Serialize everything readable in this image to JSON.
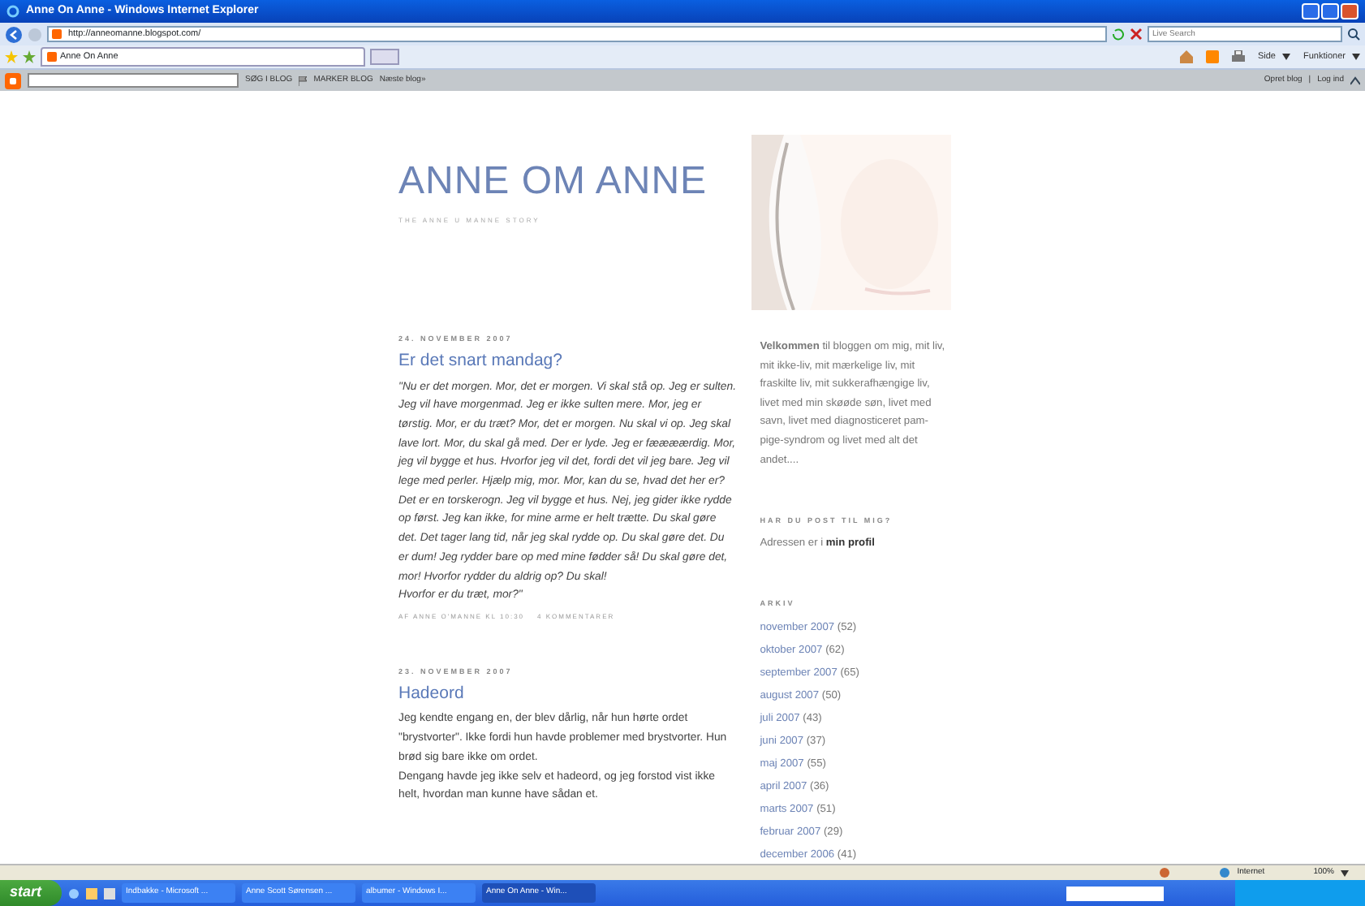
{
  "window": {
    "title": "Anne On Anne - Windows Internet Explorer"
  },
  "address_bar": {
    "url": "http://anneomanne.blogspot.com/",
    "search_placeholder": "Live Search"
  },
  "tabs": [
    {
      "label": "Anne On Anne",
      "selected": true
    }
  ],
  "command_bar": [
    "Side",
    "Funktioner"
  ],
  "blogger_bar": {
    "buttons": [
      "SØG I BLOG",
      "MARKER BLOG",
      "Næste blog»"
    ],
    "links": [
      "Opret blog",
      "Log ind"
    ],
    "separator": "|"
  },
  "blog": {
    "title": "ANNE OM ANNE",
    "description": "THE ANNE U MANNE STORY",
    "posts": [
      {
        "date": "24. NOVEMBER 2007",
        "title": "Er det snart mandag?",
        "italic": true,
        "paragraphs": [
          "\"Nu er det morgen. Mor, det er morgen. Vi skal stå op. Jeg er sulten. Jeg vil have morgenmad. Jeg er ikke sulten mere. Mor, jeg er tørstig. Mor, er du træt? Mor, det er morgen. Nu skal vi op. Jeg skal lave lort. Mor, du skal gå med. Der er lyde. Jeg er fæææærdig. Mor, jeg vil bygge et hus. Hvorfor jeg vil det, fordi det vil jeg bare. Jeg vil lege med perler. Hjælp mig, mor. Mor, kan du se, hvad det her er? Det er en torskerogn. Jeg vil bygge et hus. Nej, jeg gider ikke rydde op først. Jeg kan ikke, for mine arme er helt trætte. Du skal gøre det. Det tager lang tid, når jeg skal rydde op. Du skal gøre det. Du er dum! Jeg rydder bare op med mine fødder så! Du skal gøre det, mor! Hvorfor rydder du aldrig op? Du skal!",
          "Hvorfor er du træt, mor?\""
        ],
        "byline": "AF ANNE O'MANNE KL 10:30",
        "comments": "4 KOMMENTARER"
      },
      {
        "date": "23. NOVEMBER 2007",
        "title": "Hadeord",
        "italic": false,
        "paragraphs": [
          "Jeg kendte engang en, der blev dårlig, når hun hørte ordet \"brystvorter\". Ikke fordi hun havde problemer med brystvorter. Hun brød sig bare ikke om ordet.",
          "Dengang havde jeg ikke selv et hadeord, og jeg forstod vist ikke helt, hvordan man kunne have sådan et."
        ]
      }
    ],
    "sidebar": {
      "welcome": "**Velkommen** til bloggen om mig, mit liv, mit ikke-liv, mit mærkelige liv, mit fraskilte liv, mit sukkerafhængige liv, livet med min skøøde søn, livet med savn, livet med diagnosticeret pam-pige-syndrom og livet med alt det andet....",
      "mail_heading": "HAR DU POST TIL MIG?",
      "mail_text": "Adressen er i",
      "mail_link": "min profil",
      "archive_heading": "ARKIV",
      "archive": [
        {
          "month": "november 2007",
          "count": "(52)"
        },
        {
          "month": "oktober 2007",
          "count": "(62)"
        },
        {
          "month": "september 2007",
          "count": "(65)"
        },
        {
          "month": "august 2007",
          "count": "(50)"
        },
        {
          "month": "juli 2007",
          "count": "(43)"
        },
        {
          "month": "juni 2007",
          "count": "(37)"
        },
        {
          "month": "maj 2007",
          "count": "(55)"
        },
        {
          "month": "april 2007",
          "count": "(36)"
        },
        {
          "month": "marts 2007",
          "count": "(51)"
        },
        {
          "month": "februar 2007",
          "count": "(29)"
        },
        {
          "month": "december 2006",
          "count": "(41)"
        }
      ]
    }
  },
  "status_bar": {
    "zone": "Internet",
    "zoom": "100%"
  },
  "taskbar": {
    "start": "start",
    "tasks": [
      {
        "label": "Indbakke - Microsoft ...",
        "selected": false
      },
      {
        "label": "Anne Scott Sørensen ...",
        "selected": false
      },
      {
        "label": "albumer - Windows I...",
        "selected": false
      },
      {
        "label": "Anne On Anne - Win...",
        "selected": true
      }
    ]
  }
}
